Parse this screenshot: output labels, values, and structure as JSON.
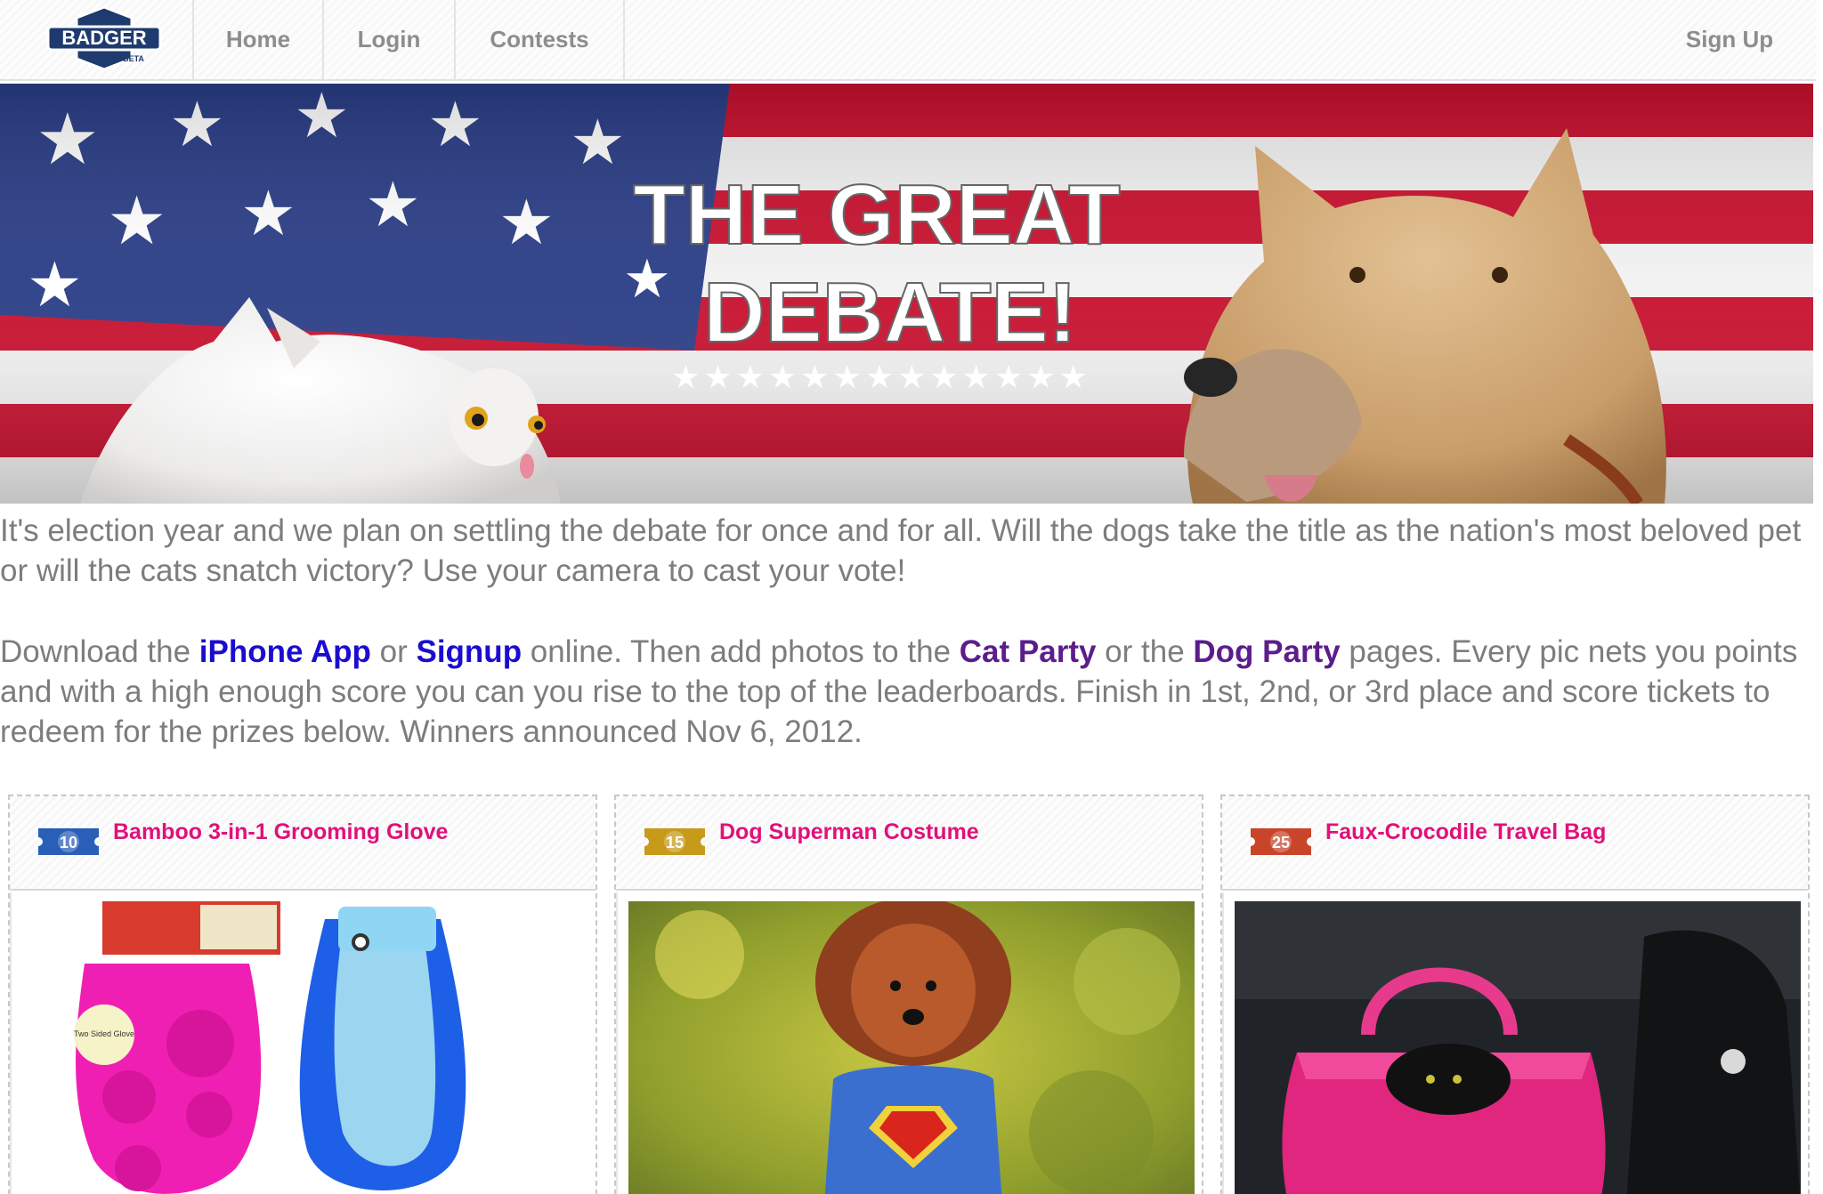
{
  "nav": {
    "logo_text": "BADGER",
    "logo_sub": "BETA",
    "home": "Home",
    "login": "Login",
    "contests": "Contests",
    "signup": "Sign Up"
  },
  "banner": {
    "line1": "THE GREAT",
    "line2": "DEBATE!",
    "stars": "★★★★★★★★★★★★★"
  },
  "intro": {
    "p1": "It's election year and we plan on settling the debate for once and for all. Will the dogs take the title as the nation's most beloved pet or will the cats snatch victory? Use your camera to cast your vote!",
    "p2_a": "Download the ",
    "iphone_app": "iPhone App",
    "p2_b": " or ",
    "signup": "Signup",
    "p2_c": " online. Then add photos to the ",
    "cat_party": "Cat Party",
    "p2_d": " or the ",
    "dog_party": "Dog Party",
    "p2_e": " pages. Every pic nets you points and with a high enough score you can you rise to the top of the leaderboards. Finish in 1st, 2nd, or 3rd place and score tickets to redeem for the prizes below. Winners announced Nov 6, 2012."
  },
  "prizes": [
    {
      "tickets": "10",
      "ticket_color": "#2a5fb8",
      "title": "Bamboo 3-in-1 Grooming Glove",
      "pkg_label": "Two Sided Glove"
    },
    {
      "tickets": "15",
      "ticket_color": "#c79a1a",
      "title": "Dog Superman Costume"
    },
    {
      "tickets": "25",
      "ticket_color": "#c8452a",
      "title": "Faux-Crocodile Travel Bag"
    }
  ]
}
